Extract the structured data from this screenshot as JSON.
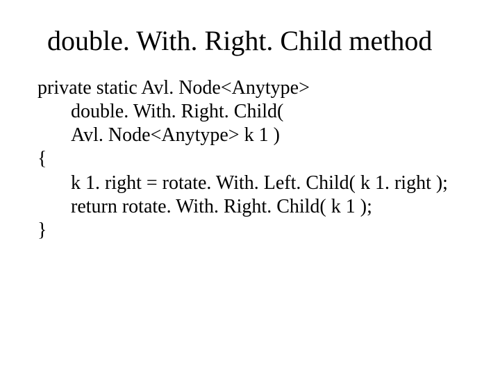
{
  "title": "double. With. Right. Child method",
  "code": {
    "l1": "private static Avl. Node<Anytype>",
    "l2": "double. With. Right. Child(",
    "l3": "Avl. Node<Anytype> k 1 )",
    "l4": "{",
    "l5": "k 1. right = rotate. With. Left. Child( k 1. right );",
    "l6": "return rotate. With. Right. Child( k 1 );",
    "l7": "}"
  }
}
